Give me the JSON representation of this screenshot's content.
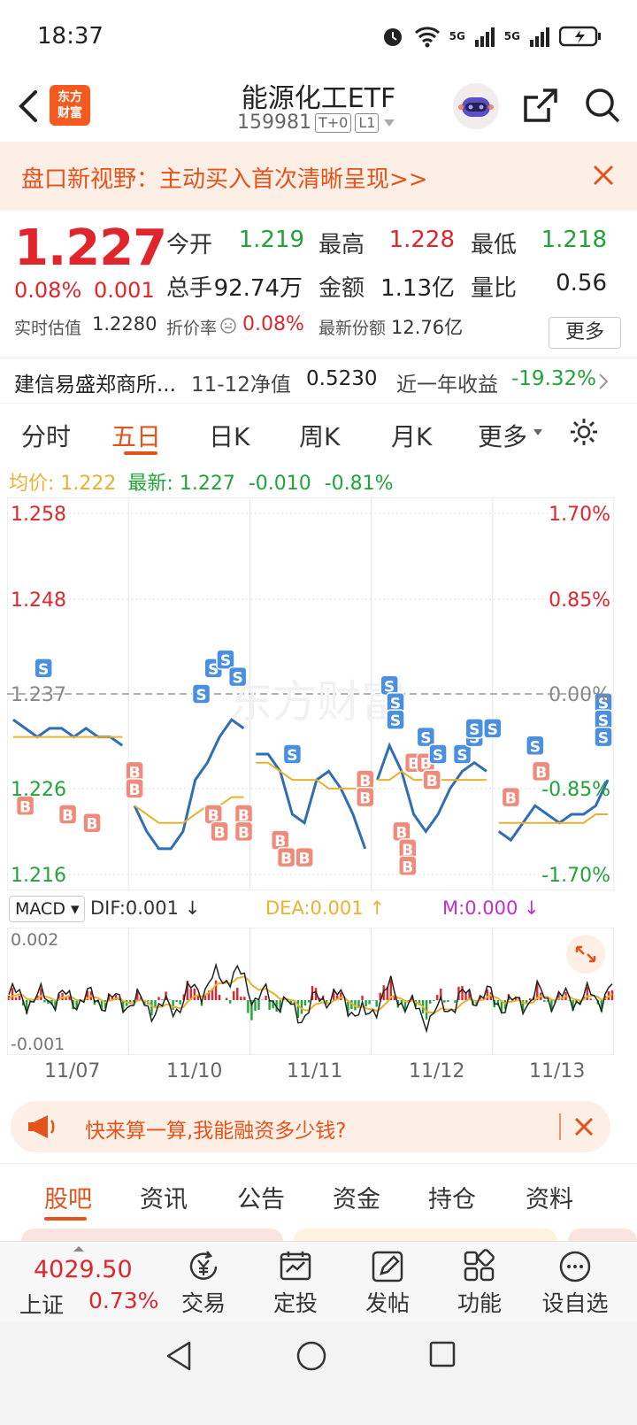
{
  "status": {
    "time": "18:37",
    "net1": "5G",
    "net2": "5G"
  },
  "header": {
    "title": "能源化工ETF",
    "code": "159981",
    "tag1": "T+0",
    "tag2": "L1",
    "logo_line1": "东方",
    "logo_line2": "财富"
  },
  "banner": {
    "text": "盘口新视野：主动买入首次清晰呈现>>"
  },
  "quote": {
    "price": "1.227",
    "change_pct": "0.08%",
    "change": "0.001",
    "open_label": "今开",
    "open": "1.219",
    "high_label": "最高",
    "high": "1.228",
    "low_label": "最低",
    "low": "1.218",
    "volume_label": "总手",
    "volume": "92.74万",
    "amount_label": "金额",
    "amount": "1.13亿",
    "ratio_label": "量比",
    "ratio": "0.56",
    "est_label": "实时估值",
    "est": "1.2280",
    "premium_label": "折价率",
    "premium": "0.08%",
    "shares_label": "最新份额",
    "shares": "12.76亿",
    "more": "更多"
  },
  "fund": {
    "name": "建信易盛郑商所...",
    "nav_label": "11-12净值",
    "nav": "0.5230",
    "return_label": "近一年收益",
    "return": "-19.32%"
  },
  "chart_tabs": [
    "分时",
    "五日",
    "日K",
    "周K",
    "月K",
    "更多"
  ],
  "chart_tab_active": 1,
  "avg": {
    "avg_label": "均价:",
    "avg": "1.222",
    "latest_label": "最新:",
    "latest": "1.227",
    "chg": "-0.010",
    "pct": "-0.81%"
  },
  "watermark": "东方财富",
  "chart_data": {
    "type": "line",
    "x": [
      "11/07",
      "11/10",
      "11/11",
      "11/12",
      "11/13"
    ],
    "y_left_ticks": [
      "1.258",
      "1.248",
      "1.237",
      "1.226",
      "1.216"
    ],
    "y_right_ticks": [
      "1.70%",
      "0.85%",
      "0.00%",
      "-0.85%",
      "-1.70%"
    ],
    "ylim": [
      1.216,
      1.258
    ],
    "ref_price": 1.237,
    "series": [
      {
        "values": [
          1.234,
          1.233,
          1.232,
          1.233,
          1.233,
          1.232,
          1.233,
          1.232,
          1.232,
          1.231,
          1.224,
          1.221,
          1.219,
          1.219,
          1.221,
          1.227,
          1.229,
          1.232,
          1.234,
          1.233,
          1.23,
          1.23,
          1.228,
          1.223,
          1.222,
          1.227,
          1.228,
          1.226,
          1.223,
          1.219,
          1.227,
          1.231,
          1.228,
          1.223,
          1.221,
          1.223,
          1.226,
          1.228,
          1.229,
          1.228,
          1.221,
          1.22,
          1.222,
          1.224,
          1.223,
          1.222,
          1.223,
          1.223,
          1.224,
          1.227
        ]
      },
      {
        "values": [
          1.232,
          1.232,
          1.232,
          1.232,
          1.232,
          1.232,
          1.232,
          1.232,
          1.232,
          1.232,
          1.224,
          1.223,
          1.222,
          1.222,
          1.222,
          1.223,
          1.224,
          1.224,
          1.225,
          1.225,
          1.229,
          1.229,
          1.228,
          1.227,
          1.227,
          1.227,
          1.226,
          1.226,
          1.226,
          1.226,
          1.227,
          1.227,
          1.228,
          1.227,
          1.227,
          1.227,
          1.227,
          1.227,
          1.227,
          1.227,
          1.222,
          1.222,
          1.222,
          1.222,
          1.222,
          1.222,
          1.222,
          1.222,
          1.223,
          1.223
        ]
      }
    ],
    "trade_marks": [
      {
        "type": "S",
        "x": 0.06,
        "y": 1.24
      },
      {
        "type": "B",
        "x": 0.03,
        "y": 1.224
      },
      {
        "type": "B",
        "x": 0.1,
        "y": 1.223
      },
      {
        "type": "B",
        "x": 0.14,
        "y": 1.222
      },
      {
        "type": "B",
        "x": 0.21,
        "y": 1.228
      },
      {
        "type": "B",
        "x": 0.21,
        "y": 1.226
      },
      {
        "type": "S",
        "x": 0.32,
        "y": 1.237
      },
      {
        "type": "S",
        "x": 0.34,
        "y": 1.24
      },
      {
        "type": "S",
        "x": 0.36,
        "y": 1.241
      },
      {
        "type": "S",
        "x": 0.38,
        "y": 1.239
      },
      {
        "type": "B",
        "x": 0.34,
        "y": 1.223
      },
      {
        "type": "B",
        "x": 0.35,
        "y": 1.221
      },
      {
        "type": "B",
        "x": 0.39,
        "y": 1.223
      },
      {
        "type": "B",
        "x": 0.39,
        "y": 1.221
      },
      {
        "type": "S",
        "x": 0.47,
        "y": 1.23
      },
      {
        "type": "B",
        "x": 0.45,
        "y": 1.22
      },
      {
        "type": "B",
        "x": 0.46,
        "y": 1.218
      },
      {
        "type": "B",
        "x": 0.49,
        "y": 1.218
      },
      {
        "type": "B",
        "x": 0.59,
        "y": 1.227
      },
      {
        "type": "B",
        "x": 0.59,
        "y": 1.225
      },
      {
        "type": "S",
        "x": 0.63,
        "y": 1.238
      },
      {
        "type": "S",
        "x": 0.64,
        "y": 1.236
      },
      {
        "type": "S",
        "x": 0.64,
        "y": 1.234
      },
      {
        "type": "B",
        "x": 0.65,
        "y": 1.221
      },
      {
        "type": "B",
        "x": 0.66,
        "y": 1.219
      },
      {
        "type": "B",
        "x": 0.66,
        "y": 1.217
      },
      {
        "type": "B",
        "x": 0.67,
        "y": 1.229
      },
      {
        "type": "B",
        "x": 0.69,
        "y": 1.229
      },
      {
        "type": "B",
        "x": 0.7,
        "y": 1.227
      },
      {
        "type": "S",
        "x": 0.69,
        "y": 1.232
      },
      {
        "type": "S",
        "x": 0.71,
        "y": 1.23
      },
      {
        "type": "S",
        "x": 0.75,
        "y": 1.23
      },
      {
        "type": "S",
        "x": 0.77,
        "y": 1.232
      },
      {
        "type": "S",
        "x": 0.77,
        "y": 1.233
      },
      {
        "type": "S",
        "x": 0.8,
        "y": 1.233
      },
      {
        "type": "B",
        "x": 0.83,
        "y": 1.225
      },
      {
        "type": "S",
        "x": 0.87,
        "y": 1.231
      },
      {
        "type": "B",
        "x": 0.88,
        "y": 1.228
      },
      {
        "type": "S",
        "x": 0.99,
        "y": 1.236
      },
      {
        "type": "S",
        "x": 1.0,
        "y": 1.234
      },
      {
        "type": "S",
        "x": 0.99,
        "y": 1.232
      }
    ]
  },
  "macd": {
    "selector": "MACD",
    "dif": "DIF:0.001",
    "dea": "DEA:0.001",
    "m": "M:0.000",
    "top": "0.002",
    "bottom": "-0.001"
  },
  "promo": {
    "text": "快来算一算,我能融资多少钱?"
  },
  "bottom_tabs": [
    "股吧",
    "资讯",
    "公告",
    "资金",
    "持仓",
    "资料"
  ],
  "index": {
    "value": "4029.50",
    "name": "上证",
    "pct": "0.73%"
  },
  "nav": [
    "交易",
    "定投",
    "发帖",
    "功能",
    "设自选"
  ],
  "colors": {
    "accent": "#e2541b",
    "up": "#e0262c",
    "down": "#22a33a",
    "avg": "#e8b230",
    "line": "#2f6db5"
  }
}
